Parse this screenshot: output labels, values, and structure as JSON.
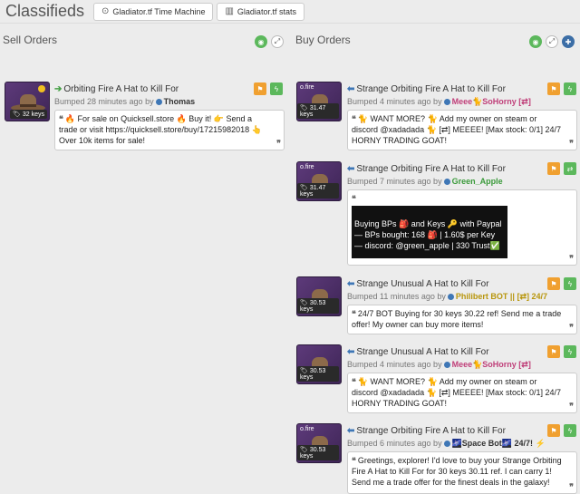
{
  "header": {
    "title": "Classifieds",
    "btn_time_machine": "Gladiator.tf Time Machine",
    "btn_stats": "Gladiator.tf stats"
  },
  "sell": {
    "heading": "Sell Orders",
    "listing": {
      "title": "Orbiting Fire A Hat to Kill For",
      "bumped": "Bumped 28 minutes ago by",
      "user": "Thomas",
      "price": "32 keys",
      "message": "🔥 For sale on Quicksell.store 🔥 Buy it! 👉 Send a trade or visit https://quicksell.store/buy/17215982018 👆 Over 10k items for sale!"
    }
  },
  "buy": {
    "heading": "Buy Orders",
    "listings": [
      {
        "title": "Strange Orbiting Fire A Hat to Kill For",
        "bumped": "Bumped 4 minutes ago by",
        "user": "Meee🐈SoHorny [⇄]",
        "price": "31.47 keys",
        "quality": "o.fire",
        "message": "🐈 WANT MORE? 🐈 Add my owner on steam or discord @xadadada 🐈 [⇄] MEEEE! [Max stock: 0/1] 24/7 HORNY TRADING GOAT!"
      },
      {
        "title": "Strange Orbiting Fire A Hat to Kill For",
        "bumped": "Bumped 7 minutes ago by",
        "user": "Green_Apple",
        "price": "31.47 keys",
        "quality": "o.fire",
        "line1": "Buying BPs 🎒 and Keys 🔑 with Paypal",
        "line2": "— BPs bought: 168 🎒 | 1.60$ per Key",
        "line3": "— discord: @green_apple | 330 Trust✅"
      },
      {
        "title": "Strange Unusual A Hat to Kill For",
        "bumped": "Bumped 11 minutes ago by",
        "user": "Philibert BOT || [⇄] 24/7",
        "price": "30.53 keys",
        "message": "24/7 BOT Buying for 30 keys 30.22 ref! Send me a trade offer! My owner can buy more items!"
      },
      {
        "title": "Strange Unusual A Hat to Kill For",
        "bumped": "Bumped 4 minutes ago by",
        "user": "Meee🐈SoHorny [⇄]",
        "price": "30.53 keys",
        "message": "🐈 WANT MORE? 🐈 Add my owner on steam or discord @xadadada 🐈 [⇄] MEEEE! [Max stock: 0/1] 24/7 HORNY TRADING GOAT!"
      },
      {
        "title": "Strange Orbiting Fire A Hat to Kill For",
        "bumped": "Bumped 6 minutes ago by",
        "user": "🌌Space Bot🌌 24/7! ⚡",
        "price": "30.53 keys",
        "quality": "o.fire",
        "message": "Greetings, explorer! I'd love to buy your Strange Orbiting Fire A Hat to Kill For for 30 keys 30.11 ref. I can carry 1! Send me a trade offer for the finest deals in the galaxy!"
      }
    ]
  }
}
